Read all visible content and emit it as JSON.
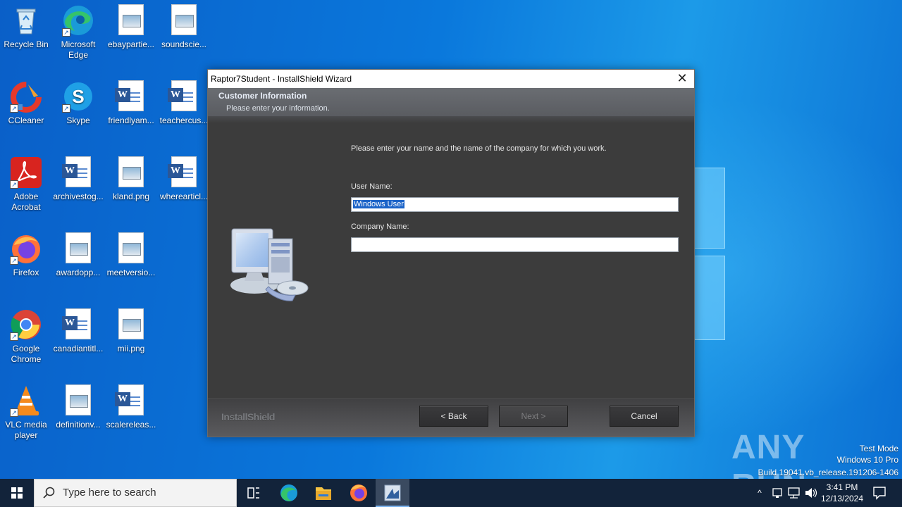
{
  "desktop": {
    "icons": [
      {
        "label": "Recycle Bin",
        "icon": "recycle-bin-icon"
      },
      {
        "label": "Microsoft Edge",
        "icon": "edge-icon"
      },
      {
        "label": "ebaypartie...",
        "icon": "image-file-icon"
      },
      {
        "label": "soundscie...",
        "icon": "image-file-icon"
      },
      {
        "label": "CCleaner",
        "icon": "ccleaner-icon"
      },
      {
        "label": "Skype",
        "icon": "skype-icon"
      },
      {
        "label": "friendlyam...",
        "icon": "word-doc-icon"
      },
      {
        "label": "teachercus...",
        "icon": "word-doc-icon"
      },
      {
        "label": "Adobe Acrobat",
        "icon": "acrobat-icon"
      },
      {
        "label": "archivestog...",
        "icon": "word-doc-icon"
      },
      {
        "label": "kland.png",
        "icon": "image-file-icon"
      },
      {
        "label": "wherearticl...",
        "icon": "word-doc-icon"
      },
      {
        "label": "Firefox",
        "icon": "firefox-icon"
      },
      {
        "label": "awardopp...",
        "icon": "image-file-icon"
      },
      {
        "label": "meetversio...",
        "icon": "image-file-icon"
      },
      {
        "label": "Google Chrome",
        "icon": "chrome-icon"
      },
      {
        "label": "canadiantitl...",
        "icon": "word-doc-icon"
      },
      {
        "label": "mii.png",
        "icon": "image-file-icon"
      },
      {
        "label": "VLC media player",
        "icon": "vlc-icon"
      },
      {
        "label": "definitionv...",
        "icon": "image-file-icon"
      },
      {
        "label": "scalereleas...",
        "icon": "word-doc-icon"
      }
    ]
  },
  "wizard": {
    "title": "Raptor7Student - InstallShield Wizard",
    "close": "✕",
    "header_title": "Customer Information",
    "header_subtitle": "Please enter your information.",
    "instruction": "Please enter your name and the name of the company for which you work.",
    "user_name_label": "User Name:",
    "user_name_value": "Windows User",
    "company_name_label": "Company Name:",
    "company_name_value": "",
    "brand": "InstallShield",
    "back_label": "< Back",
    "next_label": "Next >",
    "cancel_label": "Cancel"
  },
  "watermark": {
    "logo": "ANY RUN",
    "line1": "Test Mode",
    "line2": "Windows 10 Pro",
    "line3": "Build 19041.vb_release.191206-1406"
  },
  "taskbar": {
    "search_placeholder": "Type here to search",
    "time": "3:41 PM",
    "date": "12/13/2024",
    "apps": [
      "task-view-icon",
      "edge-icon",
      "file-explorer-icon",
      "firefox-icon",
      "installshield-icon"
    ]
  },
  "colors": {
    "accent": "#1c64c8",
    "wizard_bg": "#3c3c3c",
    "taskbar": "#12233a"
  }
}
